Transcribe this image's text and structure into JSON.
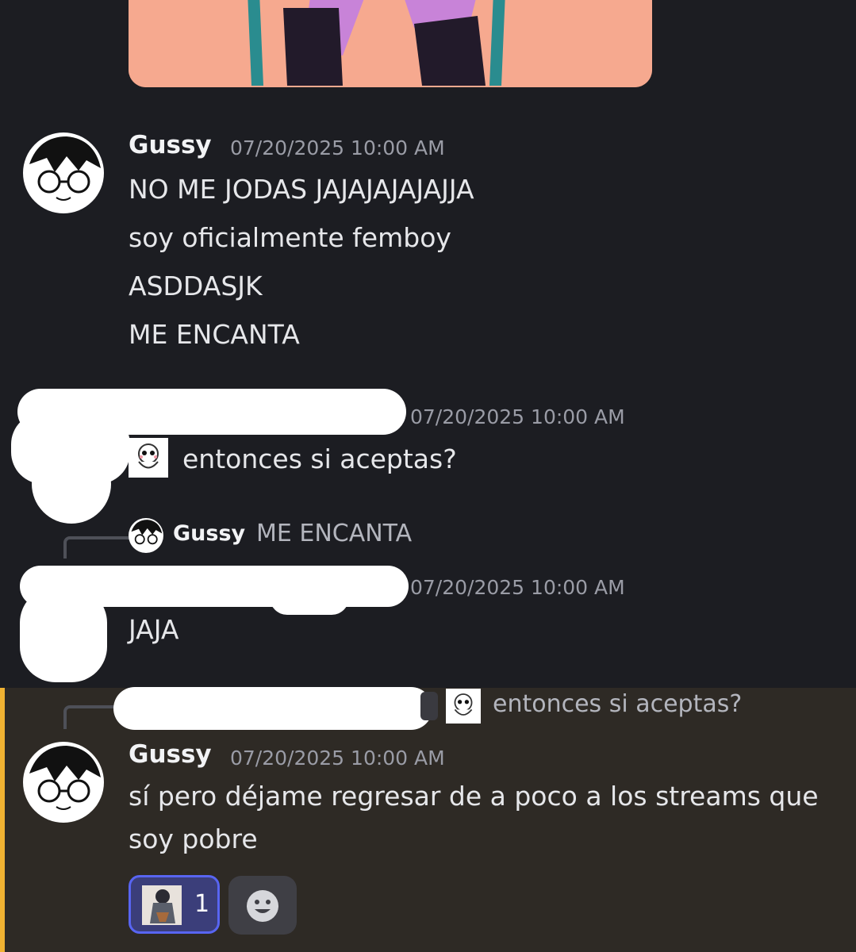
{
  "messages": [
    {
      "author": "Gussy",
      "timestamp": "07/20/2025 10:00 AM",
      "lines": [
        "NO ME JODAS JAJAJAJAJAJJA",
        "soy oficialmente femboy",
        "ASDDASJK",
        "ME ENCANTA"
      ]
    },
    {
      "author": "",
      "timestamp": "07/20/2025 10:00 AM",
      "lines": [
        "entonces si aceptas?"
      ]
    },
    {
      "reply": {
        "author": "Gussy",
        "text": "ME ENCANTA"
      },
      "author": "",
      "timestamp": "07/20/2025 10:00 AM",
      "lines": [
        "JAJA"
      ]
    },
    {
      "reply": {
        "author": "",
        "text": "entonces si aceptas?"
      },
      "author": "Gussy",
      "timestamp": "07/20/2025 10:00 AM",
      "lines": [
        "sí pero déjame regresar de a poco a los streams que",
        "soy pobre"
      ],
      "reactions": [
        {
          "count": "1"
        }
      ]
    }
  ],
  "colors": {
    "background": "#1c1d22",
    "highlight_bg": "#2e2a25",
    "highlight_bar": "#f0b232",
    "reaction_bg": "#3b3e7a",
    "reaction_border": "#5865f2"
  }
}
